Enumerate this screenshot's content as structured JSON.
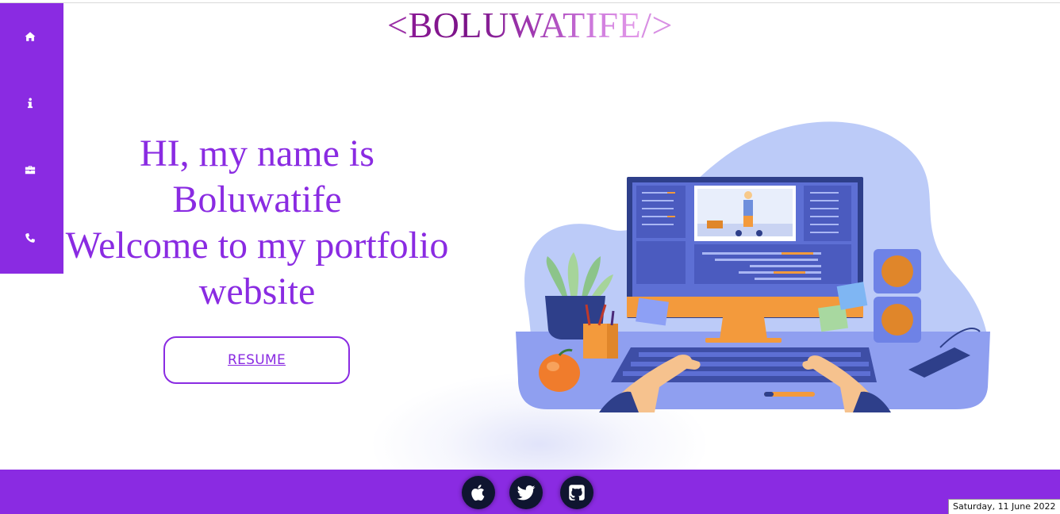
{
  "header": {
    "logo_open": "<",
    "logo_name": "BOLUWATIFE",
    "logo_close": "/>",
    "logo_colors": [
      "#9b2fa6",
      "#7b1388",
      "#8c1d95",
      "#c25bd3",
      "#d78ae3"
    ]
  },
  "sidebar": {
    "items": [
      {
        "icon": "home-icon"
      },
      {
        "icon": "info-icon"
      },
      {
        "icon": "briefcase-icon"
      },
      {
        "icon": "phone-icon"
      }
    ],
    "color": "#8a2be2"
  },
  "hero": {
    "line1": "HI, my name is",
    "line2": "Boluwatife",
    "line3": "Welcome to my portfolio",
    "line4": "website",
    "button_label": "RESUME",
    "accent": "#8a2be2"
  },
  "footer": {
    "social": [
      {
        "icon": "apple-icon"
      },
      {
        "icon": "twitter-icon"
      },
      {
        "icon": "github-icon"
      }
    ],
    "date": "Saturday, 11 June 2022"
  }
}
